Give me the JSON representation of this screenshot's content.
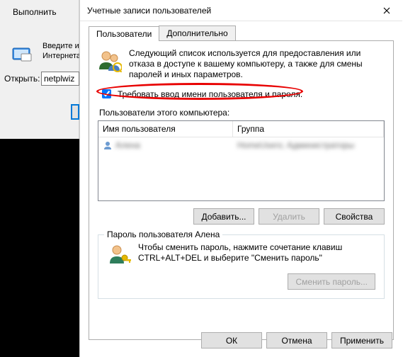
{
  "run": {
    "title": "Выполнить",
    "hint_line1": "Введите им",
    "hint_line2": "Интернета,",
    "open_label": "Открыть:",
    "input_value": "netplwiz"
  },
  "dialog": {
    "title": "Учетные записи пользователей",
    "tabs": {
      "users": "Пользователи",
      "advanced": "Дополнительно"
    },
    "blurb": "Следующий список используется для предоставления или отказа в доступе к вашему компьютеру, а также для смены паролей и иных параметров.",
    "require_login_label": "Требовать ввод имени пользователя и пароля.",
    "require_login_checked": true,
    "list_label": "Пользователи этого компьютера:",
    "columns": {
      "user": "Имя пользователя",
      "group": "Группа"
    },
    "rows": [
      {
        "user": "Алена",
        "group": "HomeUsers; Администраторы"
      }
    ],
    "buttons": {
      "add": "Добавить...",
      "remove": "Удалить",
      "props": "Свойства"
    },
    "pwd_group_title": "Пароль пользователя Алена",
    "pwd_text": "Чтобы сменить пароль, нажмите сочетание клавиш CTRL+ALT+DEL и выберите \"Сменить пароль\"",
    "pwd_button": "Сменить пароль...",
    "dlg_buttons": {
      "ok": "ОК",
      "cancel": "Отмена",
      "apply": "Применить"
    }
  }
}
